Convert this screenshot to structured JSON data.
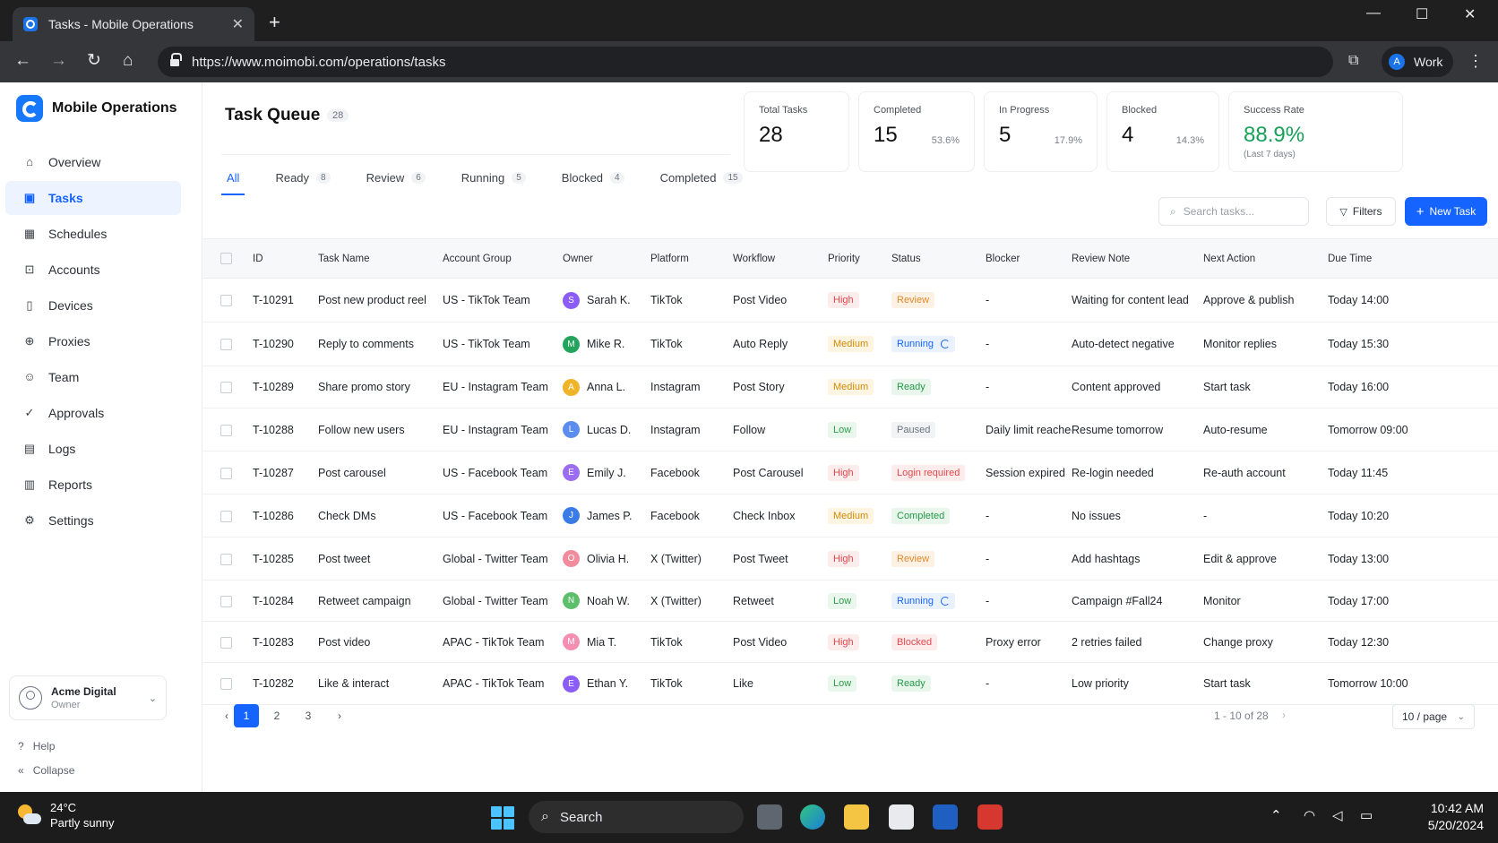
{
  "browser": {
    "tab_title": "Tasks - Mobile Operations",
    "url": "https://www.moimobi.com/operations/tasks",
    "profile_initial": "A",
    "profile_name": "Work"
  },
  "sidebar": {
    "brand": "Mobile Operations",
    "items": [
      {
        "label": "Overview",
        "icon": "home-icon"
      },
      {
        "label": "Tasks",
        "icon": "tasks-icon",
        "active": true
      },
      {
        "label": "Schedules",
        "icon": "calendar-icon"
      },
      {
        "label": "Accounts",
        "icon": "lock-icon"
      },
      {
        "label": "Devices",
        "icon": "phone-icon"
      },
      {
        "label": "Proxies",
        "icon": "globe-icon"
      },
      {
        "label": "Team",
        "icon": "team-icon"
      },
      {
        "label": "Approvals",
        "icon": "check-circle-icon"
      },
      {
        "label": "Logs",
        "icon": "file-icon"
      },
      {
        "label": "Reports",
        "icon": "bar-chart-icon"
      },
      {
        "label": "Settings",
        "icon": "gear-icon"
      }
    ],
    "account": {
      "name": "Acme Digital",
      "role": "Owner"
    },
    "help": "Help",
    "collapse": "Collapse"
  },
  "page": {
    "title": "Task Queue",
    "count": "28",
    "tabs": [
      {
        "label": "All",
        "count": ""
      },
      {
        "label": "Ready",
        "count": "8"
      },
      {
        "label": "Review",
        "count": "6"
      },
      {
        "label": "Running",
        "count": "5"
      },
      {
        "label": "Blocked",
        "count": "4"
      },
      {
        "label": "Completed",
        "count": "15"
      }
    ]
  },
  "stats": {
    "total": {
      "label": "Total Tasks",
      "value": "28"
    },
    "completed": {
      "label": "Completed",
      "value": "15",
      "pct": "53.6%"
    },
    "in_progress": {
      "label": "In Progress",
      "value": "5",
      "pct": "17.9%"
    },
    "blocked": {
      "label": "Blocked",
      "value": "4",
      "pct": "14.3%"
    },
    "success": {
      "label": "Success Rate",
      "value": "88.9%",
      "sub": "(Last 7 days)"
    }
  },
  "actions": {
    "search_placeholder": "Search tasks...",
    "filters": "Filters",
    "new_task": "New Task"
  },
  "table": {
    "headers": [
      "ID",
      "Task Name",
      "Account Group",
      "Owner",
      "Platform",
      "Workflow",
      "Priority",
      "Status",
      "Blocker",
      "Review Note",
      "Next Action",
      "Due Time"
    ],
    "rows": [
      {
        "id": "T-10291",
        "name": "Post new product reel",
        "group": "US - TikTok Team",
        "owner": "Sarah K.",
        "initial": "S",
        "avatar_color": "#8b5cf6",
        "platform": "TikTok",
        "workflow": "Post Video",
        "priority": "High",
        "status": "Review",
        "blocker": "-",
        "note": "Waiting for content lead",
        "next": "Approve & publish",
        "due": "Today 14:00"
      },
      {
        "id": "T-10290",
        "name": "Reply to comments",
        "group": "US - TikTok Team",
        "owner": "Mike R.",
        "initial": "M",
        "avatar_color": "#22a45d",
        "platform": "TikTok",
        "workflow": "Auto Reply",
        "priority": "Medium",
        "status": "Running",
        "blocker": "-",
        "note": "Auto-detect negative",
        "next": "Monitor replies",
        "due": "Today 15:30"
      },
      {
        "id": "T-10289",
        "name": "Share promo story",
        "group": "EU - Instagram Team",
        "owner": "Anna L.",
        "initial": "A",
        "avatar_color": "#f0b429",
        "platform": "Instagram",
        "workflow": "Post Story",
        "priority": "Medium",
        "status": "Ready",
        "blocker": "-",
        "note": "Content approved",
        "next": "Start task",
        "due": "Today 16:00"
      },
      {
        "id": "T-10288",
        "name": "Follow new users",
        "group": "EU - Instagram Team",
        "owner": "Lucas D.",
        "initial": "L",
        "avatar_color": "#5b8def",
        "platform": "Instagram",
        "workflow": "Follow",
        "priority": "Low",
        "status": "Paused",
        "blocker": "Daily limit reached",
        "note": "Resume tomorrow",
        "next": "Auto-resume",
        "due": "Tomorrow 09:00"
      },
      {
        "id": "T-10287",
        "name": "Post carousel",
        "group": "US - Facebook Team",
        "owner": "Emily J.",
        "initial": "E",
        "avatar_color": "#9b6cf0",
        "platform": "Facebook",
        "workflow": "Post Carousel",
        "priority": "High",
        "status": "Login required",
        "blocker": "Session expired",
        "note": "Re-login needed",
        "next": "Re-auth account",
        "due": "Today 11:45"
      },
      {
        "id": "T-10286",
        "name": "Check DMs",
        "group": "US - Facebook Team",
        "owner": "James P.",
        "initial": "J",
        "avatar_color": "#3b7be8",
        "platform": "Facebook",
        "workflow": "Check Inbox",
        "priority": "Medium",
        "status": "Completed",
        "blocker": "-",
        "note": "No issues",
        "next": "-",
        "due": "Today 10:20"
      },
      {
        "id": "T-10285",
        "name": "Post tweet",
        "group": "Global - Twitter Team",
        "owner": "Olivia H.",
        "initial": "O",
        "avatar_color": "#f28b9b",
        "platform": "X (Twitter)",
        "workflow": "Post Tweet",
        "priority": "High",
        "status": "Review",
        "blocker": "-",
        "note": "Add hashtags",
        "next": "Edit & approve",
        "due": "Today 13:00"
      },
      {
        "id": "T-10284",
        "name": "Retweet campaign",
        "group": "Global - Twitter Team",
        "owner": "Noah W.",
        "initial": "N",
        "avatar_color": "#5cbf6a",
        "platform": "X (Twitter)",
        "workflow": "Retweet",
        "priority": "Low",
        "status": "Running",
        "blocker": "-",
        "note": "Campaign #Fall24",
        "next": "Monitor",
        "due": "Today 17:00"
      },
      {
        "id": "T-10283",
        "name": "Post video",
        "group": "APAC - TikTok Team",
        "owner": "Mia T.",
        "initial": "M",
        "avatar_color": "#f48fb1",
        "platform": "TikTok",
        "workflow": "Post Video",
        "priority": "High",
        "status": "Blocked",
        "blocker": "Proxy error",
        "note": "2 retries failed",
        "next": "Change proxy",
        "due": "Today 12:30"
      },
      {
        "id": "T-10282",
        "name": "Like & interact",
        "group": "APAC - TikTok Team",
        "owner": "Ethan Y.",
        "initial": "E",
        "avatar_color": "#8b5cf6",
        "platform": "TikTok",
        "workflow": "Like",
        "priority": "Low",
        "status": "Ready",
        "blocker": "-",
        "note": "Low priority",
        "next": "Start task",
        "due": "Tomorrow 10:00"
      }
    ]
  },
  "pagination": {
    "pages": [
      "1",
      "2",
      "3"
    ],
    "current": "1",
    "range": "1 - 10 of 28",
    "page_size": "10 / page"
  },
  "taskbar": {
    "temp": "24°C",
    "weather": "Partly sunny",
    "search": "Search",
    "time": "10:42 AM",
    "date": "5/20/2024"
  }
}
